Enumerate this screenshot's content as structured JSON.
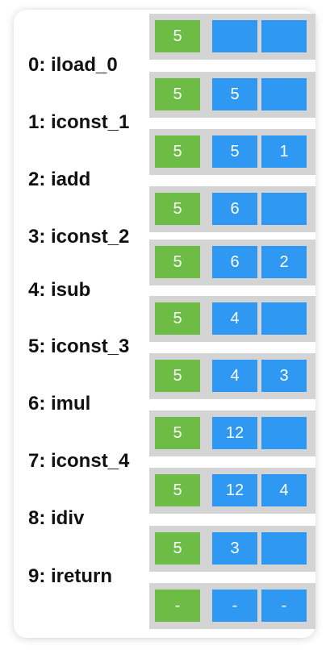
{
  "instructions": [
    "0: iload_0",
    "1: iconst_1",
    "2: iadd",
    "3: iconst_2",
    "4: isub",
    "5: iconst_3",
    "6: imul",
    "7: iconst_4",
    "8: idiv",
    "9: ireturn"
  ],
  "states": [
    {
      "local": "5",
      "stack": [
        "",
        ""
      ]
    },
    {
      "local": "5",
      "stack": [
        "5",
        ""
      ]
    },
    {
      "local": "5",
      "stack": [
        "5",
        "1"
      ]
    },
    {
      "local": "5",
      "stack": [
        "6",
        ""
      ]
    },
    {
      "local": "5",
      "stack": [
        "6",
        "2"
      ]
    },
    {
      "local": "5",
      "stack": [
        "4",
        ""
      ]
    },
    {
      "local": "5",
      "stack": [
        "4",
        "3"
      ]
    },
    {
      "local": "5",
      "stack": [
        "12",
        ""
      ]
    },
    {
      "local": "5",
      "stack": [
        "12",
        "4"
      ]
    },
    {
      "local": "5",
      "stack": [
        "3",
        ""
      ]
    },
    {
      "local": "-",
      "stack": [
        "-",
        "-"
      ]
    }
  ],
  "colors": {
    "local_variable": "#6cbc45",
    "operand_stack": "#2f98f2",
    "row_background": "#d4d4d4",
    "frame": "#ffffff"
  }
}
